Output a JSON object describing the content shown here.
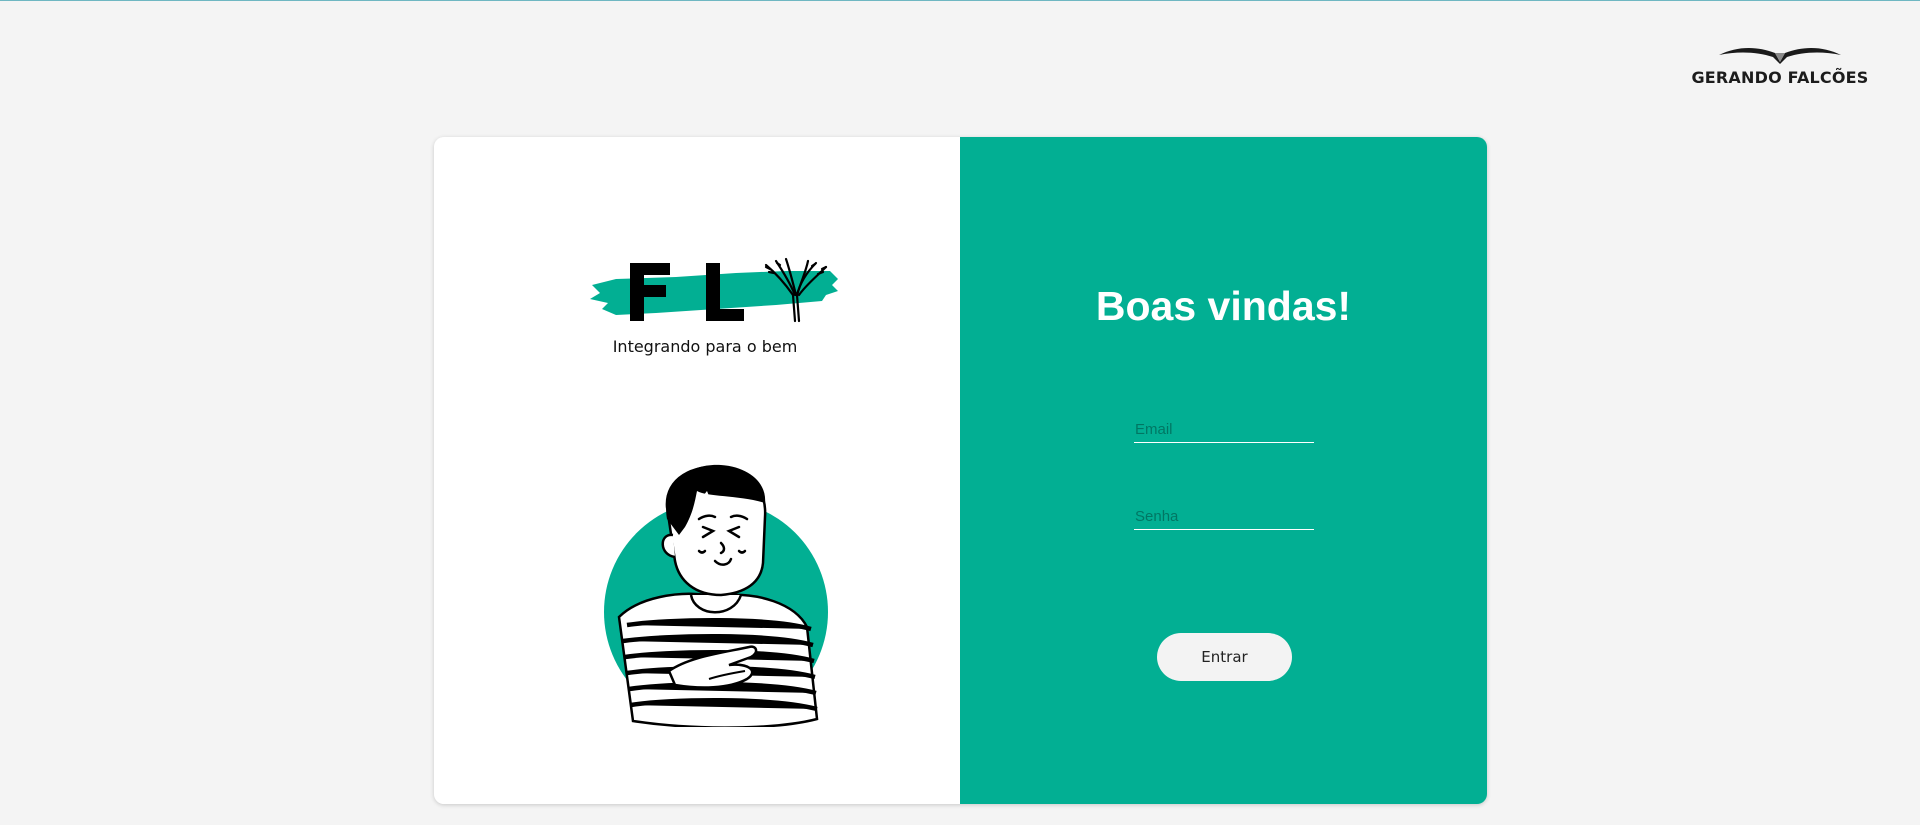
{
  "brand": {
    "name": "GERANDO FALCÕES",
    "icon": "bird-wings-logo"
  },
  "left_panel": {
    "logo_letters": "FLY",
    "logo_icon": "wheat-bundle-icon",
    "tagline": "Integrando para o bem",
    "illustration": "smiling-person-illustration"
  },
  "login": {
    "title": "Boas vindas!",
    "email_placeholder": "Email",
    "password_placeholder": "Senha",
    "submit_label": "Entrar"
  },
  "colors": {
    "accent": "#02af93",
    "background": "#f4f4f4",
    "card_left": "#ffffff",
    "button_bg": "#f3f3f3"
  }
}
